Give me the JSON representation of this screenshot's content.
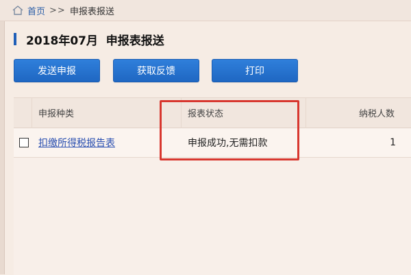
{
  "breadcrumb": {
    "home_label": "首页",
    "separator": ">>",
    "current": "申报表报送"
  },
  "page": {
    "title": "2018年07月  申报表报送"
  },
  "toolbar": {
    "send_label": "发送申报",
    "feedback_label": "获取反馈",
    "print_label": "打印"
  },
  "table": {
    "headers": [
      "申报种类",
      "报表状态",
      "纳税人数"
    ],
    "rows": [
      {
        "kind": "扣缴所得税报告表",
        "status": "申报成功,无需扣款",
        "count": "1"
      }
    ]
  },
  "colors": {
    "accent": "#1f67c2",
    "highlight": "#d8372f",
    "link": "#2a4fb0"
  },
  "icons": [
    "home-icon"
  ]
}
